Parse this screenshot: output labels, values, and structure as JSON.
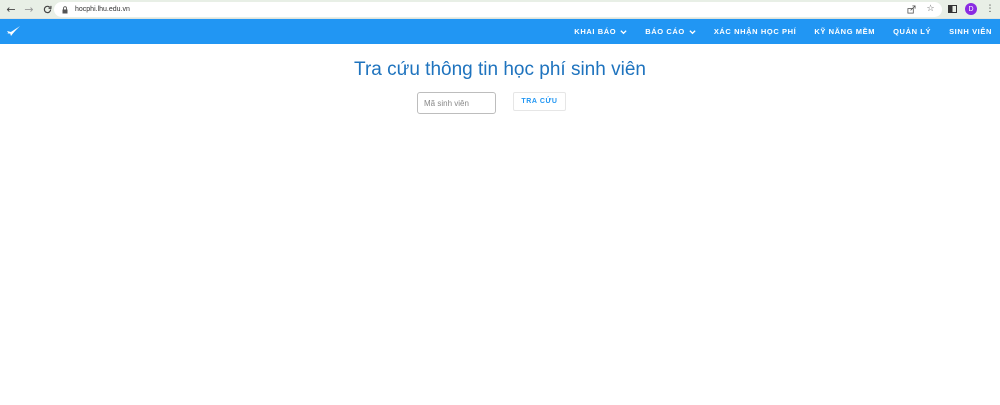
{
  "browser": {
    "url": "hocphi.lhu.edu.vn",
    "profile_initial": "D",
    "icons": [
      "back-icon",
      "forward-icon",
      "reload-icon",
      "lock-icon",
      "share-icon",
      "star-icon",
      "sidepanel-icon",
      "more-icon"
    ]
  },
  "navbar": {
    "color": "#2196f3",
    "menu": [
      {
        "label": "KHAI BÁO",
        "dropdown": true
      },
      {
        "label": "BÁO CÁO",
        "dropdown": true
      },
      {
        "label": "XÁC NHẬN HỌC PHÍ",
        "dropdown": false
      },
      {
        "label": "KỸ NĂNG MỀM",
        "dropdown": false
      },
      {
        "label": "QUẢN LÝ",
        "dropdown": false
      },
      {
        "label": "SINH VIÊN",
        "dropdown": false
      }
    ]
  },
  "main": {
    "title": "Tra cứu thông tin học phí sinh viên",
    "search": {
      "placeholder": "Mã sinh viên",
      "value": "",
      "button_label": "TRA CỨU"
    }
  }
}
